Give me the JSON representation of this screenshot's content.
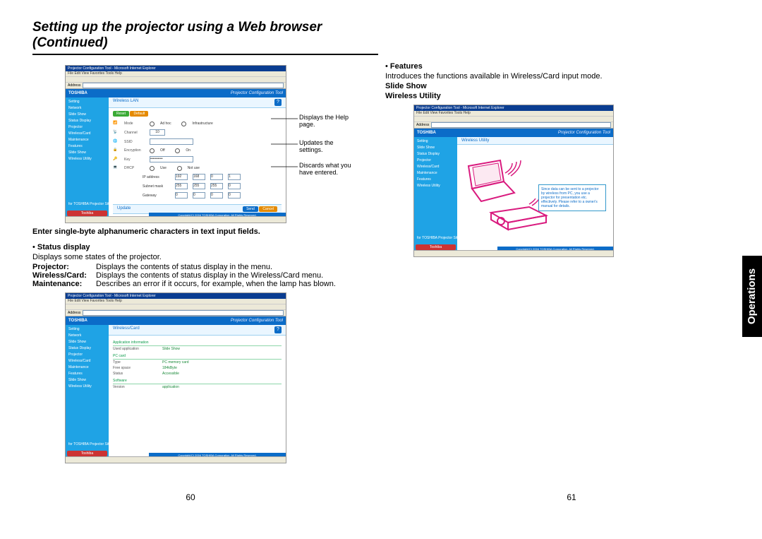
{
  "heading": "Setting up the projector using a Web browser (Continued)",
  "pageNumbers": {
    "left": "60",
    "right": "61"
  },
  "sideTab": "Operations",
  "left": {
    "note": "Enter single-byte alphanumeric characters in text input fields.",
    "statusDisplay": {
      "title": "Status display",
      "desc": "Displays some states of the projector.",
      "rows": [
        {
          "label": "Projector:",
          "val": "Displays the contents of status display in the menu."
        },
        {
          "label": "Wireless/Card:",
          "val": "Displays the contents of status display in the Wireless/Card menu."
        },
        {
          "label": "Maintenance:",
          "val": "Describes an error if it occurs, for example, when the lamp has blown."
        }
      ]
    }
  },
  "right": {
    "features": {
      "title": "Features",
      "desc": "Introduces the functions available in Wireless/Card input mode.",
      "sub1": "Slide Show",
      "sub2": "Wireless Utility"
    }
  },
  "callouts": {
    "help": "Displays the Help page.",
    "update": "Updates the settings.",
    "discard": "Discards what you have entered."
  },
  "browser": {
    "title": "Projector Configuration Tool - Microsoft Internet Explorer",
    "menu": "File   Edit   View   Favorites   Tools   Help",
    "addressLabel": "Address"
  },
  "config": {
    "brand": "TOSHIBA",
    "toolLabel": "Projector Configuration Tool",
    "copyright": "Copyright(C) 2004 TOSHIBA Corporation, All Rights Reserved.",
    "sidebar1": [
      "Setting",
      "Network",
      "Slide Show",
      "Status Display",
      "Projector",
      "Wireless/Card",
      "Maintenance",
      "Features",
      "Slide Show",
      "Wireless Utility"
    ],
    "sidebarFooter": "for TOSHIBA Projector Site",
    "toshibaBtn": "Toshiba"
  },
  "screen1": {
    "mainTitle": "Wireless LAN",
    "btnReset": "Reset",
    "btnDefault": "Default",
    "btnSend": "Send",
    "btnCancel": "Cancel",
    "help": "?",
    "rows": {
      "mode": {
        "label": "Mode",
        "opt1": "Ad hoc",
        "opt2": "Infrastructure"
      },
      "channel": {
        "label": "Channel",
        "value": "10"
      },
      "ssid": {
        "label": "SSID"
      },
      "encryption": {
        "label": "Encryption",
        "opt1": "Off",
        "opt2": "On"
      },
      "key": {
        "label": "Key",
        "value": "••••••••••"
      },
      "dhcp": {
        "label": "DHCP",
        "opt1": "Use",
        "opt2": "Not use"
      }
    },
    "ipLabel": "IP address",
    "ip": [
      "192",
      "168",
      "0",
      "1"
    ],
    "maskLabel": "Subnet mask",
    "mask": [
      "255",
      "255",
      "255",
      "0"
    ],
    "gwLabel": "Gateway",
    "gw": [
      "0",
      "0",
      "0",
      "0"
    ],
    "updateTitle": "Update"
  },
  "screen2": {
    "mainTitle": "Wireless/Card",
    "sec1": "Application information",
    "k1": "Used application",
    "v1": "Slide Show",
    "sec2": "PC card",
    "k2": "Type",
    "v2": "PC memory card",
    "k3": "Free space",
    "v3": "184kByte",
    "k4": "Status",
    "v4": "Accessible",
    "sec3": "Software",
    "k5": "Version",
    "v5": "application"
  },
  "screen3": {
    "mainTitle": "Wireless Utility",
    "noteText": "Since data can be sent to a projector by wireless from PC, you use a projector for presentation etc. effectively. Please refer to a owner's manual for details."
  }
}
